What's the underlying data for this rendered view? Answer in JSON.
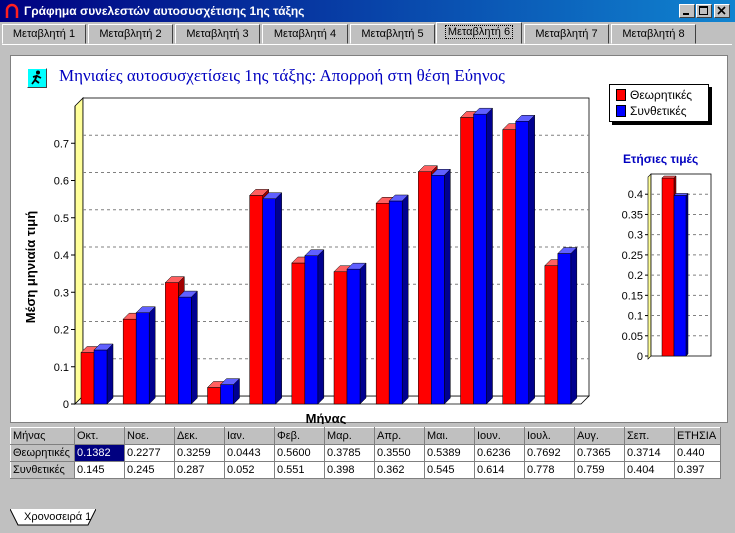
{
  "window": {
    "title": "Γράφημα συνελεστών αυτοσυσχέτισης 1ης τάξης"
  },
  "tabs": [
    "Μεταβλητή 1",
    "Μεταβλητή 2",
    "Μεταβλητή 3",
    "Μεταβλητή 4",
    "Μεταβλητή 5",
    "Μεταβλητή 6",
    "Μεταβλητή 7",
    "Μεταβλητή 8"
  ],
  "active_tab": "Μεταβλητή 6",
  "colors": {
    "theoretical": "#ff0000",
    "synthetic": "#0000ff",
    "title": "#0000c0",
    "window_title_bg": "#000080",
    "wall": "#ffff99"
  },
  "chart_data": [
    {
      "type": "bar",
      "title": "Μηνιαίες αυτοσυσχετίσεις 1ης τάξης: Απορροή στη θέση Εύηνος",
      "xlabel": "Μήνας",
      "ylabel": "Μέση μηνιαία τιμή",
      "ylim": [
        0,
        0.8
      ],
      "yticks": [
        "0",
        "0.1",
        "0.2",
        "0.3",
        "0.4",
        "0.5",
        "0.6",
        "0.7"
      ],
      "grid": true,
      "legend_position": "top-right",
      "categories": [
        "Οκτ.",
        "Νοε.",
        "Δεκ.",
        "Ιαν.",
        "Φεβ.",
        "Μαρ.",
        "Απρ.",
        "Μαι.",
        "Ιουν.",
        "Ιουλ.",
        "Αυγ.",
        "Σεπ."
      ],
      "series": [
        {
          "name": "Θεωρητικές",
          "values": [
            0.1382,
            0.2277,
            0.3259,
            0.0443,
            0.56,
            0.3785,
            0.355,
            0.5389,
            0.6236,
            0.7692,
            0.7365,
            0.3714
          ]
        },
        {
          "name": "Συνθετικές",
          "values": [
            0.145,
            0.245,
            0.287,
            0.052,
            0.551,
            0.398,
            0.362,
            0.545,
            0.614,
            0.778,
            0.759,
            0.404
          ]
        }
      ]
    },
    {
      "type": "bar",
      "title": "Ετήσιες τιμές",
      "ylim": [
        0,
        0.45
      ],
      "yticks": [
        "0",
        "0.05",
        "0.1",
        "0.15",
        "0.2",
        "0.25",
        "0.3",
        "0.35",
        "0.4"
      ],
      "grid": true,
      "series": [
        {
          "name": "Θεωρητικές",
          "values": [
            0.44
          ]
        },
        {
          "name": "Συνθετικές",
          "values": [
            0.397
          ]
        }
      ]
    }
  ],
  "table": {
    "header": [
      "Μήνας",
      "Οκτ.",
      "Νοε.",
      "Δεκ.",
      "Ιαν.",
      "Φεβ.",
      "Μαρ.",
      "Απρ.",
      "Μαι.",
      "Ιουν.",
      "Ιουλ.",
      "Αυγ.",
      "Σεπ.",
      "ΕΤΗΣΙΑ"
    ],
    "rows": [
      [
        "Θεωρητικές",
        "0.1382",
        "0.2277",
        "0.3259",
        "0.0443",
        "0.5600",
        "0.3785",
        "0.3550",
        "0.5389",
        "0.6236",
        "0.7692",
        "0.7365",
        "0.3714",
        "0.440"
      ],
      [
        "Συνθετικές",
        "0.145",
        "0.245",
        "0.287",
        "0.052",
        "0.551",
        "0.398",
        "0.362",
        "0.545",
        "0.614",
        "0.778",
        "0.759",
        "0.404",
        "0.397"
      ]
    ]
  },
  "sheet_tab": "Χρονοσειρά 1"
}
